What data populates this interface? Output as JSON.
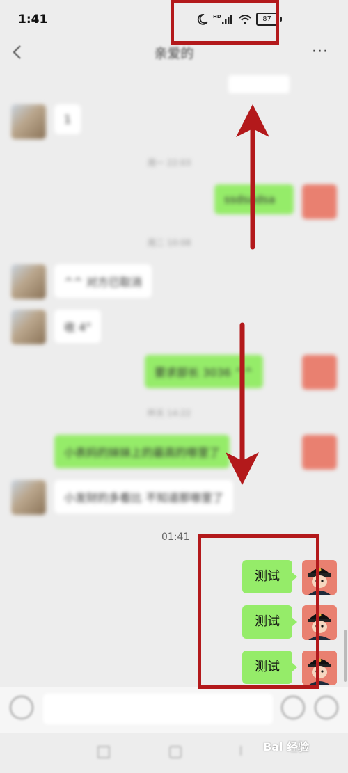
{
  "status_bar": {
    "time": "1:41",
    "hd_label": "HD",
    "battery": "87"
  },
  "header": {
    "title": "亲爱的",
    "more": "···"
  },
  "history": {
    "msg1": "1",
    "time1": "周一 22:03",
    "msg2": "ssdsadsa",
    "time2": "周二 10:08",
    "msg3": "^^ 对方已取消",
    "msg4": "收 4°",
    "msg5": "要求部长 3036 ^^",
    "time3": "昨天 14:22",
    "msg6": "小表妈的妹妹上的最高的哪里了",
    "msg7": "小发财的多看比 不知道那哪里了"
  },
  "chat": {
    "timestamp": "01:41",
    "test_messages": [
      "测试",
      "测试",
      "测试"
    ]
  },
  "watermark": "Bai 经验",
  "colors": {
    "green_bubble": "#95ec69",
    "annotation_red": "#b3191b",
    "background": "#ededed"
  }
}
